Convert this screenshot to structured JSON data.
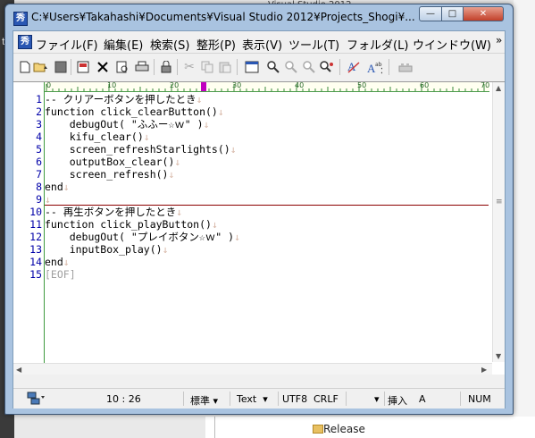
{
  "background": {
    "left_text": "t",
    "top_text": "Visual Studio 2012",
    "bottom_item": "Release"
  },
  "window": {
    "title": "C:¥Users¥Takahashi¥Documents¥Visual Studio 2012¥Projects_Shogi¥...",
    "app_icon": "秀",
    "buttons": {
      "minimize": "—",
      "maximize": "□",
      "close": "✕"
    }
  },
  "menu": {
    "items": [
      "ファイル(F)",
      "編集(E)",
      "検索(S)",
      "整形(P)",
      "表示(V)",
      "ツール(T)",
      "フォルダ(L)",
      "ウインドウ(W)"
    ],
    "more": "»"
  },
  "toolbar": {
    "icons": [
      "new-file-icon",
      "open-folder-icon",
      "save-icon",
      "save-all-icon",
      "close-icon",
      "preview-icon",
      "print-icon",
      "lock-icon",
      "cut-icon",
      "copy-icon",
      "paste-icon",
      "window-icon",
      "search-icon",
      "search-prev-icon",
      "search-next-icon",
      "replace-icon",
      "font-icon",
      "spell-icon",
      "macro-icon"
    ]
  },
  "ruler": {
    "labels": [
      "0",
      "10",
      "20",
      "30",
      "40",
      "50",
      "60",
      "70"
    ]
  },
  "editor": {
    "eol_mark": "↓",
    "lines": [
      {
        "n": "1",
        "text": "-- クリアーボタンを押したとき",
        "eol": true
      },
      {
        "n": "2",
        "text": "function click_clearButton()",
        "eol": true
      },
      {
        "n": "3",
        "text": "    debugOut( \"ふふー☆ｗ\" )",
        "eol": true
      },
      {
        "n": "4",
        "text": "    kifu_clear()",
        "eol": true
      },
      {
        "n": "5",
        "text": "    screen_refreshStarlights()",
        "eol": true
      },
      {
        "n": "6",
        "text": "    outputBox_clear()",
        "eol": true
      },
      {
        "n": "7",
        "text": "    screen_refresh()",
        "eol": true
      },
      {
        "n": "8",
        "text": "end",
        "eol": true
      },
      {
        "n": "9",
        "text": "",
        "eol": true
      },
      {
        "n": "10",
        "text": "-- 再生ボタンを押したとき",
        "eol": true
      },
      {
        "n": "11",
        "text": "function click_playButton()",
        "eol": true
      },
      {
        "n": "12",
        "text": "    debugOut( \"プレイボタン☆ｗ\" )",
        "eol": true
      },
      {
        "n": "13",
        "text": "    inputBox_play()",
        "eol": true
      },
      {
        "n": "14",
        "text": "end",
        "eol": true
      },
      {
        "n": "15",
        "text": "[EOF]",
        "eol": false
      }
    ]
  },
  "status": {
    "position": "10 : 26",
    "mode": "標準",
    "file_type": "Text",
    "encoding": "UTF8",
    "line_ending": "CRLF",
    "insert": "挿入",
    "ime": "A",
    "numlock": "NUM"
  }
}
